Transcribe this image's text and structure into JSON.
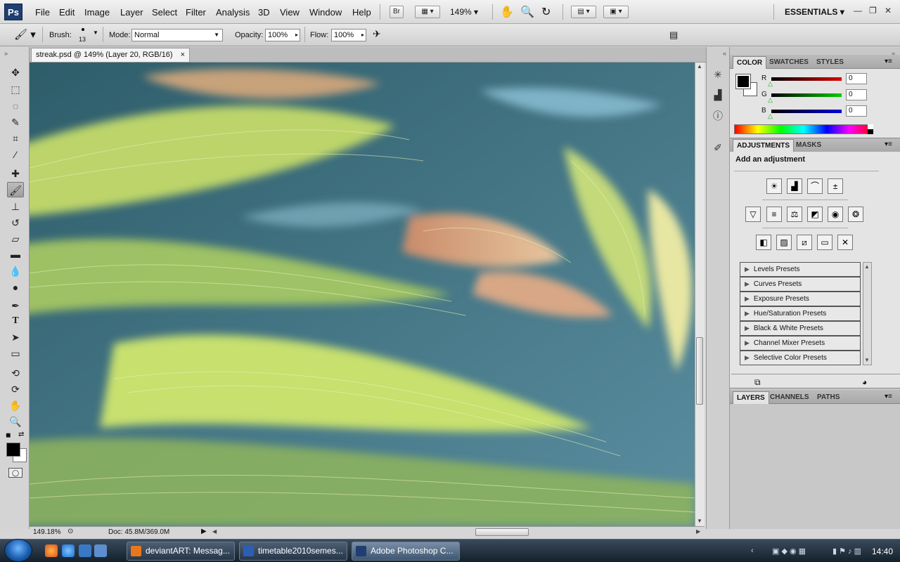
{
  "app": {
    "logo": "Ps",
    "workspace": "ESSENTIALS"
  },
  "menu": [
    "File",
    "Edit",
    "Image",
    "Layer",
    "Select",
    "Filter",
    "Analysis",
    "3D",
    "View",
    "Window",
    "Help"
  ],
  "appbar": {
    "bridge": "Br",
    "zoom": "149%"
  },
  "options": {
    "brush_label": "Brush:",
    "brush_size": "13",
    "mode_label": "Mode:",
    "mode_value": "Normal",
    "opacity_label": "Opacity:",
    "opacity_value": "100%",
    "flow_label": "Flow:",
    "flow_value": "100%"
  },
  "document": {
    "tab_title": "streak.psd @ 149% (Layer 20, RGB/16)",
    "close": "×"
  },
  "status": {
    "zoom": "149.18%",
    "doc": "Doc: 45.8M/369.0M"
  },
  "color_panel": {
    "tabs": [
      "COLOR",
      "SWATCHES",
      "STYLES"
    ],
    "channels": [
      {
        "label": "R",
        "value": "0",
        "color": "#cc0000"
      },
      {
        "label": "G",
        "value": "0",
        "color": "#00bb00"
      },
      {
        "label": "B",
        "value": "0",
        "color": "#0000cc"
      }
    ]
  },
  "adjust_panel": {
    "tabs": [
      "ADJUSTMENTS",
      "MASKS"
    ],
    "heading": "Add an adjustment",
    "presets": [
      "Levels Presets",
      "Curves Presets",
      "Exposure Presets",
      "Hue/Saturation Presets",
      "Black & White Presets",
      "Channel Mixer Presets",
      "Selective Color Presets"
    ]
  },
  "layers_panel": {
    "tabs": [
      "LAYERS",
      "CHANNELS",
      "PATHS"
    ]
  },
  "taskbar": {
    "items": [
      {
        "label": "deviantART: Messag...",
        "color": "#e8761c"
      },
      {
        "label": "timetable2010semes...",
        "color": "#2b5fb3"
      },
      {
        "label": "Adobe Photoshop C...",
        "color": "#1f3f72"
      }
    ],
    "clock": "14:40"
  },
  "icons": {
    "tools": [
      "move-icon",
      "marquee-icon",
      "lasso-icon",
      "quick-select-icon",
      "crop-icon",
      "eyedropper-icon",
      "healing-icon",
      "brush-icon",
      "stamp-icon",
      "history-brush-icon",
      "eraser-icon",
      "gradient-icon",
      "blur-icon",
      "dodge-icon",
      "pen-icon",
      "type-icon",
      "path-select-icon",
      "shape-icon",
      "3d-rotate-icon",
      "3d-orbit-icon",
      "hand-icon",
      "zoom-icon"
    ]
  }
}
